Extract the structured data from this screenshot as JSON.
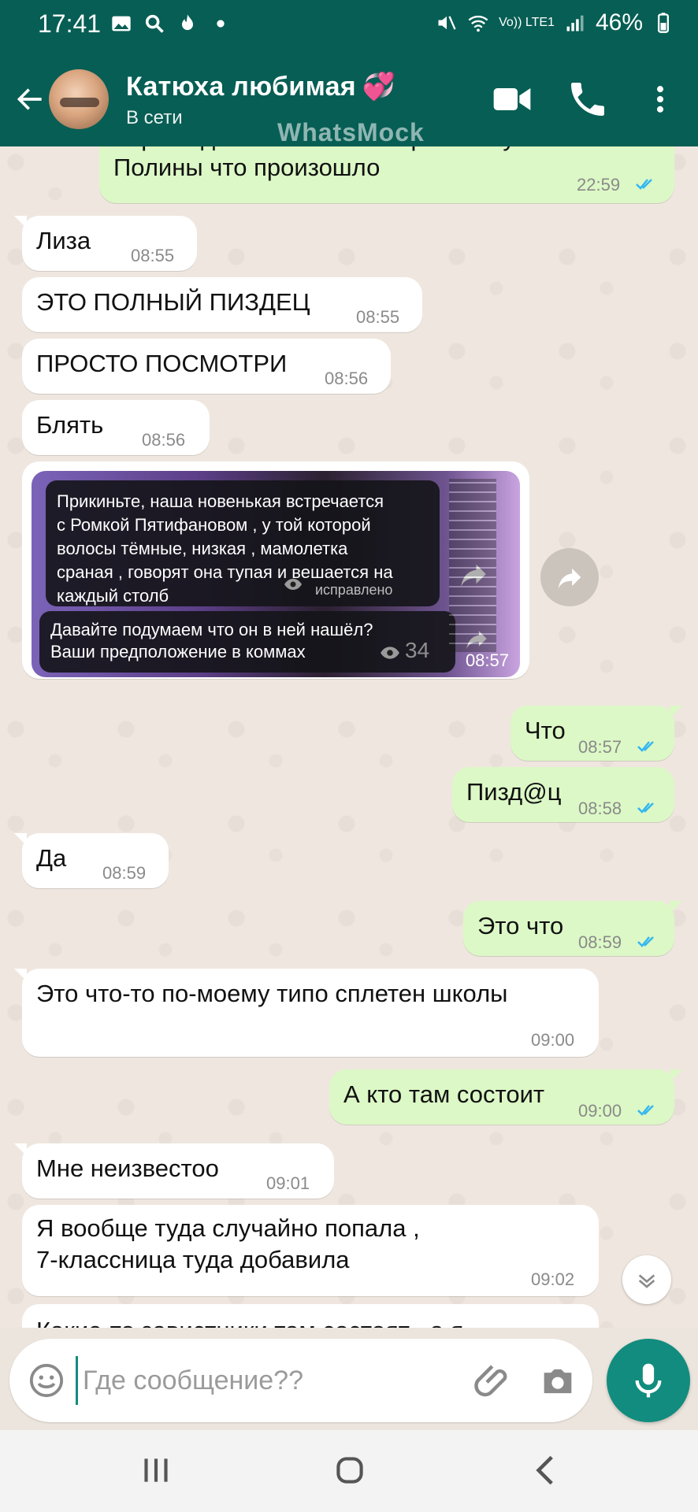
{
  "status_bar": {
    "time": "17:41",
    "network": "Vo)) LTE1",
    "battery": "46%"
  },
  "header": {
    "contact_name": "Катюха любимая",
    "heart": "💞",
    "status": "В сети",
    "watermark": "WhatsMock"
  },
  "messages": [
    {
      "dir": "out",
      "text_line1": "Короче давай ты потом спросишь у",
      "text_line2": "Полины что произошло",
      "time": "22:59",
      "read": true
    },
    {
      "dir": "in",
      "text": "Лиза",
      "time": "08:55"
    },
    {
      "dir": "in",
      "text": "ЭТО ПОЛНЫЙ ПИЗДЕЦ",
      "time": "08:55"
    },
    {
      "dir": "in",
      "text": "ПРОСТО ПОСМОТРИ",
      "time": "08:56"
    },
    {
      "dir": "in",
      "text": "Блять",
      "time": "08:56"
    },
    {
      "dir": "out",
      "text": "Что",
      "time": "08:57",
      "read": true
    },
    {
      "dir": "out",
      "text": "Пизд@ц",
      "time": "08:58",
      "read": true
    },
    {
      "dir": "in",
      "text": "Да",
      "time": "08:59"
    },
    {
      "dir": "out",
      "text": "Это что",
      "time": "08:59",
      "read": true
    },
    {
      "dir": "in",
      "text": "Это что-то по-моему типо сплетен школы",
      "time": "09:00"
    },
    {
      "dir": "out",
      "text": "А кто там состоит",
      "time": "09:00",
      "read": true
    },
    {
      "dir": "in",
      "text": "Мне неизвестоо",
      "time": "09:01"
    },
    {
      "dir": "in",
      "text_line1": "Я вообще туда случайно попала ,",
      "text_line2": "7-классница туда добавила",
      "time": "09:02"
    },
    {
      "dir": "in",
      "text": "Какие-то завистники там состоят , а я"
    }
  ],
  "media": {
    "caption1_lines": [
      "Прикиньте, наша новенькая встречается",
      "с Ромкой Пятифановом , у той которой",
      "волосы тёмные,  низкая , мамолетка",
      "сраная , говорят она тупая и вешается на",
      "каждый столб"
    ],
    "edited": "исправлено",
    "caption2_lines": [
      "Давайте подумаем что он в ней нашёл?",
      "Ваши предположение в коммах"
    ],
    "views": "34",
    "time": "08:57"
  },
  "input": {
    "placeholder": "Где сообщение??"
  },
  "colors": {
    "header": "#075e54",
    "accent": "#128c7e",
    "outgoing": "#dcf8c6",
    "read_ticks": "#34b7f1"
  }
}
